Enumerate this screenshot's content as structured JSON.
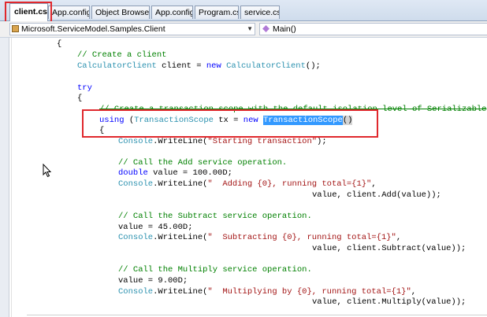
{
  "tabs": [
    {
      "label": "client.cs",
      "active": true
    },
    {
      "label": "App.config",
      "active": false
    },
    {
      "label": "Object Browser",
      "active": false
    },
    {
      "label": "App.config",
      "active": false
    },
    {
      "label": "Program.cs",
      "active": false
    },
    {
      "label": "service.cs",
      "active": false
    }
  ],
  "navbar": {
    "type_combo": "Microsoft.ServiceModel.Samples.Client",
    "member_combo": "Main()"
  },
  "code": {
    "l_brace_open": "{",
    "l_comment_create": "// Create a client",
    "l_client_type": "CalculatorClient",
    "l_client_mid": " client = ",
    "l_new1": "new",
    "l_client_ctor": "CalculatorClient",
    "l_client_end": "();",
    "l_try": "try",
    "l_try_brace": "{",
    "l_comment_scope": "// Create a transaction scope with the default isolation level of Serializable",
    "l_using": "using",
    "l_using_paren": " (",
    "l_scope_type": "TransactionScope",
    "l_scope_mid": " tx = ",
    "l_new2": "new",
    "l_scope_ctor": "TransactionScope",
    "l_scope_end": "()",
    "l_using_brace": "{",
    "l_console": "Console",
    "l_writeline_start": ".WriteLine(",
    "l_str_starting": "\"Starting transaction\"",
    "l_close_semicolon": ");",
    "l_comment_add": "// Call the Add service operation.",
    "l_double": "double",
    "l_value_decl": " value = 100.00D;",
    "l_str_adding": "\"  Adding {0}, running total={1}\"",
    "l_comma": ",",
    "l_add_args": "value, client.Add(value));",
    "l_comment_subtract": "// Call the Subtract service operation.",
    "l_value_45": "value = 45.00D;",
    "l_str_subtracting": "\"  Subtracting {0}, running total={1}\"",
    "l_subtract_args": "value, client.Subtract(value));",
    "l_comment_multiply": "// Call the Multiply service operation.",
    "l_value_9": "value = 9.00D;",
    "l_str_multiplying": "\"  Multiplying by {0}, running total={1}\"",
    "l_multiply_args": "value, client.Multiply(value));"
  },
  "colors": {
    "keyword": "#0000ff",
    "type": "#2b91af",
    "comment": "#008000",
    "string": "#a31515",
    "selection": "#3399ff",
    "annotation_box": "#e0282d"
  },
  "icons": {
    "type_combo_icon": "class-icon",
    "member_combo_icon": "method-icon",
    "pointer": "mouse-cursor-icon"
  }
}
